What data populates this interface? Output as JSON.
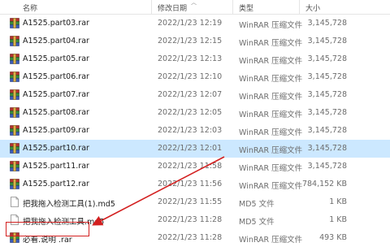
{
  "columns": {
    "name": "名称",
    "date": "修改日期",
    "type": "类型",
    "size": "大小"
  },
  "files": [
    {
      "name": "A1525.part03.rar",
      "date": "2022/1/23 12:19",
      "type": "WinRAR 压缩文件",
      "size": "3,145,728",
      "icon": "winrar-archive-icon",
      "state": ""
    },
    {
      "name": "A1525.part04.rar",
      "date": "2022/1/23 12:15",
      "type": "WinRAR 压缩文件",
      "size": "3,145,728",
      "icon": "winrar-archive-icon",
      "state": ""
    },
    {
      "name": "A1525.part05.rar",
      "date": "2022/1/23 12:13",
      "type": "WinRAR 压缩文件",
      "size": "3,145,728",
      "icon": "winrar-archive-icon",
      "state": ""
    },
    {
      "name": "A1525.part06.rar",
      "date": "2022/1/23 12:10",
      "type": "WinRAR 压缩文件",
      "size": "3,145,728",
      "icon": "winrar-archive-icon",
      "state": ""
    },
    {
      "name": "A1525.part07.rar",
      "date": "2022/1/23 12:07",
      "type": "WinRAR 压缩文件",
      "size": "3,145,728",
      "icon": "winrar-archive-icon",
      "state": ""
    },
    {
      "name": "A1525.part08.rar",
      "date": "2022/1/23 12:05",
      "type": "WinRAR 压缩文件",
      "size": "3,145,728",
      "icon": "winrar-archive-icon",
      "state": ""
    },
    {
      "name": "A1525.part09.rar",
      "date": "2022/1/23 12:03",
      "type": "WinRAR 压缩文件",
      "size": "3,145,728",
      "icon": "winrar-archive-icon",
      "state": ""
    },
    {
      "name": "A1525.part10.rar",
      "date": "2022/1/23 12:01",
      "type": "WinRAR 压缩文件",
      "size": "3,145,728",
      "icon": "winrar-archive-icon",
      "state": "selected"
    },
    {
      "name": "A1525.part11.rar",
      "date": "2022/1/23 11:58",
      "type": "WinRAR 压缩文件",
      "size": "3,145,728",
      "icon": "winrar-archive-icon",
      "state": ""
    },
    {
      "name": "A1525.part12.rar",
      "date": "2022/1/23 11:56",
      "type": "WinRAR 压缩文件",
      "size": "784,152 KB",
      "icon": "winrar-archive-icon",
      "state": ""
    },
    {
      "name": "把我拖入检测工具(1).md5",
      "date": "2022/1/23 11:55",
      "type": "MD5 文件",
      "size": "1 KB",
      "icon": "document-icon",
      "state": ""
    },
    {
      "name": "把我拖入检测工具.md5",
      "date": "2022/1/23 11:28",
      "type": "MD5 文件",
      "size": "1 KB",
      "icon": "document-icon",
      "state": ""
    },
    {
      "name": "必看.说明 .rar",
      "date": "2022/1/23 11:28",
      "type": "WinRAR 压缩文件",
      "size": "493 KB",
      "icon": "winrar-archive-icon",
      "state": ""
    }
  ],
  "colors": {
    "selected": "#cce8ff",
    "annotation": "#d32020"
  }
}
